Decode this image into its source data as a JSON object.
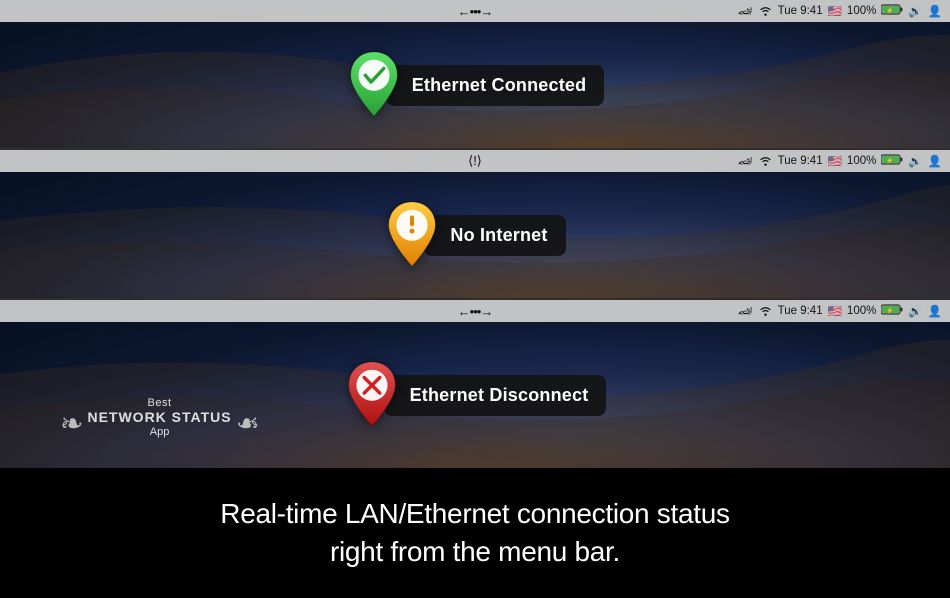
{
  "panels": [
    {
      "id": "panel-1",
      "menubar": {
        "center_icon": "⟵•••⟶",
        "items": [
          "🏎",
          "WiFi",
          "Tue 9:41",
          "🇺🇸",
          "100%",
          "🔋",
          "🔊",
          "👤"
        ]
      },
      "status": {
        "label": "Ethernet Connected",
        "color": "green",
        "icon_type": "check"
      }
    },
    {
      "id": "panel-2",
      "menubar": {
        "center_icon": "⟨!⟩",
        "items": [
          "🏎",
          "WiFi",
          "Tue 9:41",
          "🇺🇸",
          "100%",
          "🔋",
          "🔊",
          "👤"
        ]
      },
      "status": {
        "label": "No Internet",
        "color": "orange",
        "icon_type": "exclamation"
      }
    },
    {
      "id": "panel-3",
      "menubar": {
        "center_icon": "⟵•••⟶",
        "items": [
          "🏎",
          "WiFi",
          "Tue 9:41",
          "🇺🇸",
          "100%",
          "🔋",
          "🔊",
          "👤"
        ]
      },
      "status": {
        "label": "Ethernet Disconnect",
        "color": "red",
        "icon_type": "cross"
      },
      "award": {
        "pre": "Best",
        "title": "NETWORK STATUS",
        "sub": "App"
      }
    }
  ],
  "footer": {
    "line1": "Real-time LAN/Ethernet connection status",
    "line2": "right from the menu bar."
  },
  "menubar_time": "Tue 9:41",
  "menubar_battery": "100%",
  "colors": {
    "green": "#3dba4e",
    "orange": "#f5a623",
    "red": "#e03030"
  }
}
